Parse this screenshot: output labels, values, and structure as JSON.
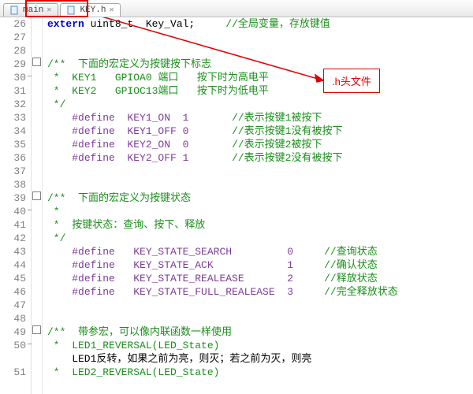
{
  "tabs": [
    {
      "label": "main",
      "active": false,
      "close": true
    },
    {
      "label": "KEY.h",
      "active": true,
      "close": true
    }
  ],
  "annotation": {
    "label": ".h头文件"
  },
  "gutter": {
    "start": 26,
    "end": 51
  },
  "code": {
    "26": [
      [
        "kw",
        "extern"
      ],
      [
        "blk",
        " uint8_t  Key_Val;"
      ],
      [
        "blk",
        "     "
      ],
      [
        "cmg",
        "//全局变量，存放键值"
      ]
    ],
    "27": [],
    "28": [],
    "29": [
      [
        "cmg",
        "/**  下面的宏定义为按键按下标志"
      ]
    ],
    "30": [
      [
        "cmg",
        " *  KEY1   GPIOA0 端口   按下时为高电平"
      ]
    ],
    "31": [
      [
        "cmg",
        " *  KEY2   GPIOC13端口   按下时为低电平"
      ]
    ],
    "32": [
      [
        "cmg",
        " */"
      ]
    ],
    "33": [
      [
        "blk",
        "    "
      ],
      [
        "ppl",
        "#define  KEY1_ON  1"
      ],
      [
        "blk",
        "       "
      ],
      [
        "cmg",
        "//表示按键1被按下"
      ]
    ],
    "34": [
      [
        "blk",
        "    "
      ],
      [
        "ppl",
        "#define  KEY1_OFF 0"
      ],
      [
        "blk",
        "       "
      ],
      [
        "cmg",
        "//表示按键1没有被按下"
      ]
    ],
    "35": [
      [
        "blk",
        "    "
      ],
      [
        "ppl",
        "#define  KEY2_ON  0"
      ],
      [
        "blk",
        "       "
      ],
      [
        "cmg",
        "//表示按键2被按下"
      ]
    ],
    "36": [
      [
        "blk",
        "    "
      ],
      [
        "ppl",
        "#define  KEY2_OFF 1"
      ],
      [
        "blk",
        "       "
      ],
      [
        "cmg",
        "//表示按键2没有被按下"
      ]
    ],
    "37": [],
    "38": [],
    "39": [
      [
        "cmg",
        "/**  下面的宏定义为按键状态"
      ]
    ],
    "40": [
      [
        "cmg",
        " *"
      ]
    ],
    "41": [
      [
        "cmg",
        " *  按键状态：查询、按下、释放"
      ]
    ],
    "42": [
      [
        "cmg",
        " */"
      ]
    ],
    "43": [
      [
        "blk",
        "    "
      ],
      [
        "ppl",
        "#define   KEY_STATE_SEARCH         0"
      ],
      [
        "blk",
        "     "
      ],
      [
        "cmg",
        "//查询状态"
      ]
    ],
    "44": [
      [
        "blk",
        "    "
      ],
      [
        "ppl",
        "#define   KEY_STATE_ACK            1"
      ],
      [
        "blk",
        "     "
      ],
      [
        "cmg",
        "//确认状态"
      ]
    ],
    "45": [
      [
        "blk",
        "    "
      ],
      [
        "ppl",
        "#define   KEY_STATE_REALEASE       2"
      ],
      [
        "blk",
        "     "
      ],
      [
        "cmg",
        "//释放状态"
      ]
    ],
    "46": [
      [
        "blk",
        "    "
      ],
      [
        "ppl",
        "#define   KEY_STATE_FULL_REALEASE  3"
      ],
      [
        "blk",
        "     "
      ],
      [
        "cmg",
        "//完全释放状态"
      ]
    ],
    "47": [],
    "48": [],
    "49": [
      [
        "cmg",
        "/**  带参宏，可以像内联函数一样使用"
      ]
    ],
    "50": [
      [
        "cmg",
        " *  LED1_REVERSAL(LED_State)"
      ]
    ],
    "50b": [
      [
        "blk",
        "    LED1反转，如果之前为亮，则灭；若之前为灭，则亮"
      ]
    ],
    "51": [
      [
        "cmg",
        " *  LED2_REVERSAL(LED_State)"
      ]
    ]
  },
  "fold_markers": [
    "29",
    "39",
    "49"
  ]
}
